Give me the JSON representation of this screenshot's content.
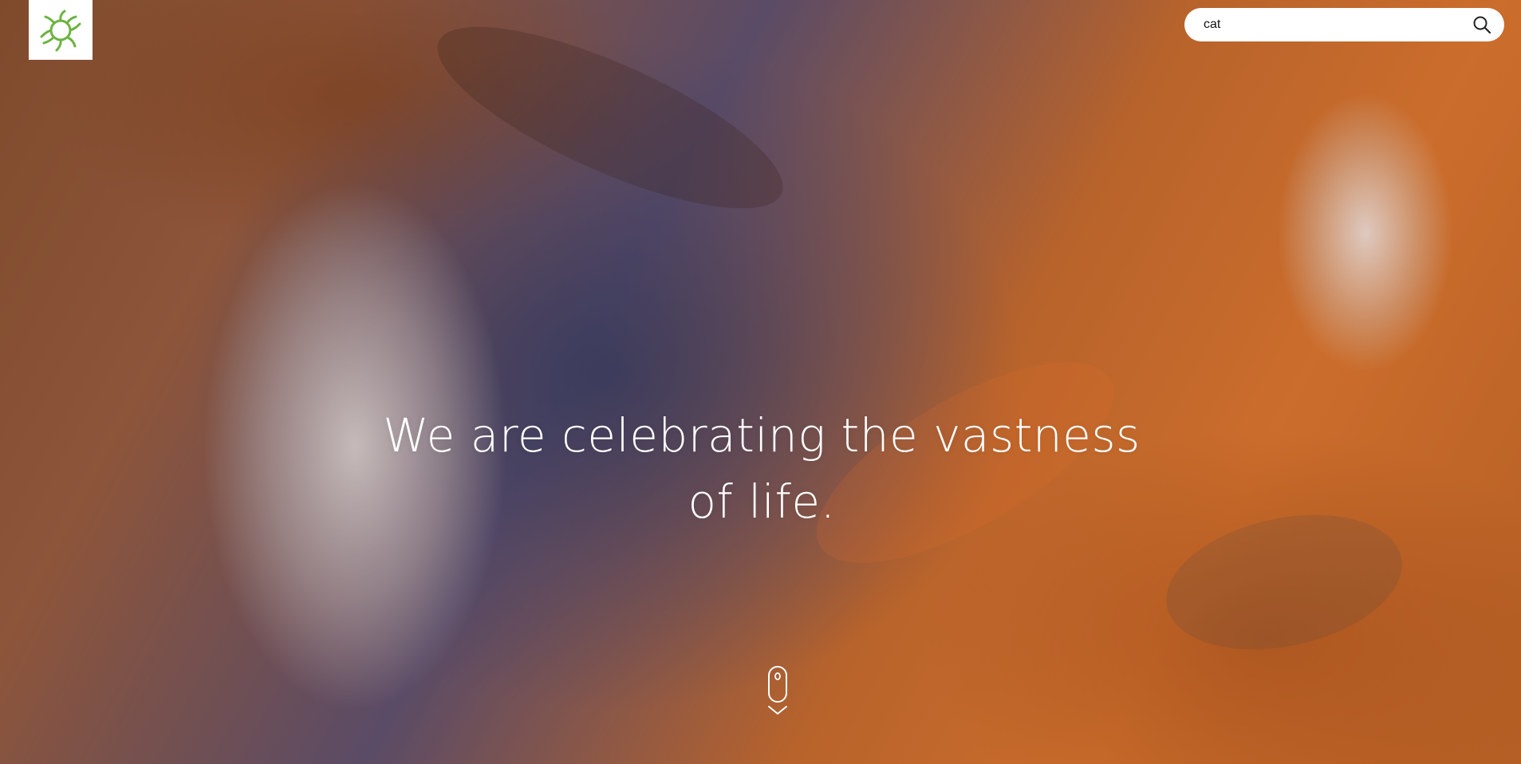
{
  "search": {
    "value": "cat"
  },
  "hero": {
    "headline_line1": "We are celebrating the vastness",
    "headline_line2": "of life."
  },
  "icons": {
    "logo": "sun-leaf-logo-icon",
    "search": "search-icon",
    "scroll": "mouse-scroll-down-icon"
  },
  "colors": {
    "logo_green": "#6cb33f",
    "text": "#ffffff",
    "search_bg": "#ffffff"
  }
}
